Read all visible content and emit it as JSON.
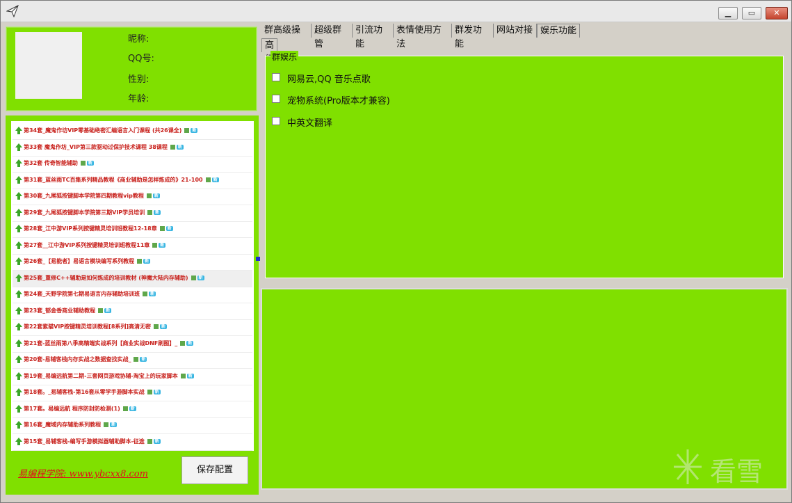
{
  "profile": {
    "nickname_label": "昵称:",
    "qq_label": "QQ号:",
    "gender_label": "性别:",
    "age_label": "年龄:"
  },
  "course_list": [
    {
      "text": "第34套_魔鬼作坊VIP零基础绝密汇编语言入门课程 (共26课全)"
    },
    {
      "text": "第33套 魔鬼作坊_VIP第三款驱动过保护技术课程 38课程"
    },
    {
      "text": "第32套 传奇智能辅助"
    },
    {
      "text": "第31套_蓝丝雨TC百集系列精品教程《商业辅助是怎样炼成的》21-100"
    },
    {
      "text": "第30套_九尾狐按键脚本学院第四期教程vip教程"
    },
    {
      "text": "第29套_九尾狐按键脚本学院第三期VIP学员培训"
    },
    {
      "text": "第28套_江中游VIP系列按键精灵培训班教程12-18章"
    },
    {
      "text": "第27套__江中游VIP系列按键精灵培训班教程11章"
    },
    {
      "text": "第26套_【易能者】易语言模块编写系列教程"
    },
    {
      "text": "第25套_重修C++辅助是如何炼成的培训教材 (神魔大陆内存辅助)"
    },
    {
      "text": "第24套_天野学院第七期易语言内存辅助培训班"
    },
    {
      "text": "第23套_郁金香商业辅助教程"
    },
    {
      "text": "第22套紫猫VIP按键精灵培训教程[8系列]高清无密"
    },
    {
      "text": "第21套-蓝丝雨第八季高精端实战系列【商业实战DNF刷图】_"
    },
    {
      "text": "第20套-易辅客栈内存实战之数据查找实战_"
    },
    {
      "text": "第19套_易编远航第二期-三套网页游戏协辅-淘宝上的玩家脚本"
    },
    {
      "text": "第18套。_易辅客栈-第16套从零学手游脚本实战"
    },
    {
      "text": "第17套。易编远航 程序防封防检测(1)"
    },
    {
      "text": "第16套_魔域内存辅助系列教程"
    },
    {
      "text": "第15套_易辅客栈-编写手游模拟器辅助脚本-征途"
    }
  ],
  "site_link": "易编程学院: www.ybcxx8.com",
  "save_button": "保存配置",
  "tabs": [
    "群高级操作",
    "超级群管",
    "引流功能",
    "表情使用方法",
    "群发功能",
    "网站对接",
    "娱乐功能"
  ],
  "active_tab": "娱乐功能",
  "subtab": "高级娱乐功能",
  "group": {
    "title": "群娱乐",
    "options": [
      {
        "label": "网易云,QQ 音乐点歌",
        "checked": false
      },
      {
        "label": "宠物系统(Pro版本才兼容)",
        "checked": false
      },
      {
        "label": "中英文翻译",
        "checked": false
      }
    ]
  },
  "badge_new": "新",
  "watermark_text": "看雪",
  "colors": {
    "panel_green": "#80e000",
    "list_text": "#c8211c",
    "link_red": "#e0101a"
  }
}
